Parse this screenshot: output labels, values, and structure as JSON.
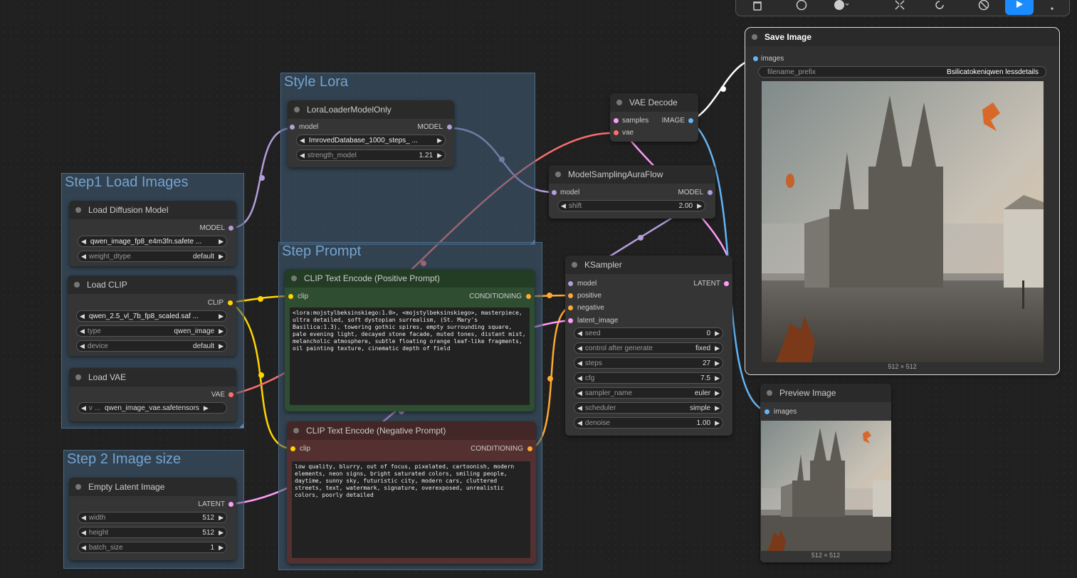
{
  "groups": {
    "style_lora": "Style Lora",
    "load_images": "Step1 Load Images",
    "prompt": "Step Prompt",
    "image_size": "Step 2 Image size"
  },
  "nodes": {
    "lora": {
      "title": "LoraLoaderModelOnly",
      "in_model": "model",
      "out_model": "MODEL",
      "lora_name": "ImrovedDatabase_1000_steps_ ...",
      "strength_label": "strength_model",
      "strength_value": "1.21"
    },
    "load_diffusion": {
      "title": "Load Diffusion Model",
      "out_model": "MODEL",
      "unet_name": "qwen_image_fp8_e4m3fn.safete ...",
      "weight_label": "weight_dtype",
      "weight_value": "default"
    },
    "load_clip": {
      "title": "Load CLIP",
      "out_clip": "CLIP",
      "clip_name": "qwen_2.5_vl_7b_fp8_scaled.saf ...",
      "type_label": "type",
      "type_value": "qwen_image",
      "device_label": "device",
      "device_value": "default"
    },
    "load_vae": {
      "title": "Load VAE",
      "out_vae": "VAE",
      "vae_label": "v ...",
      "vae_value": "qwen_image_vae.safetensors"
    },
    "empty_latent": {
      "title": "Empty Latent Image",
      "out_latent": "LATENT",
      "width_label": "width",
      "width_value": "512",
      "height_label": "height",
      "height_value": "512",
      "batch_label": "batch_size",
      "batch_value": "1"
    },
    "clip_positive": {
      "title": "CLIP Text Encode (Positive Prompt)",
      "in_clip": "clip",
      "out_cond": "CONDITIONING",
      "text": "<lora:mojstylbeksinskiego:1.0>, <mojstylbeksinskiego>, masterpiece, ultra detailed, soft dystopian surrealism, (St. Mary's Basilica:1.3), towering gothic spires, empty surrounding square, pale evening light, decayed stone facade, muted tones, distant mist, melancholic atmosphere, subtle floating orange leaf-like fragments, oil painting texture, cinematic depth of field"
    },
    "clip_negative": {
      "title": "CLIP Text Encode (Negative Prompt)",
      "in_clip": "clip",
      "out_cond": "CONDITIONING",
      "text": "low quality, blurry, out of focus, pixelated, cartoonish, modern elements, neon signs, bright saturated colors, smiling people, daytime, sunny sky, futuristic city, modern cars, cluttered streets, text, watermark, signature, overexposed, unrealistic colors, poorly detailed"
    },
    "vae_decode": {
      "title": "VAE Decode",
      "in_samples": "samples",
      "in_vae": "vae",
      "out_image": "IMAGE"
    },
    "model_sampling": {
      "title": "ModelSamplingAuraFlow",
      "in_model": "model",
      "out_model": "MODEL",
      "shift_label": "shift",
      "shift_value": "2.00"
    },
    "ksampler": {
      "title": "KSampler",
      "in_model": "model",
      "in_positive": "positive",
      "in_negative": "negative",
      "in_latent": "latent_image",
      "out_latent": "LATENT",
      "widgets": [
        {
          "label": "seed",
          "value": "0"
        },
        {
          "label": "control after generate",
          "value": "fixed"
        },
        {
          "label": "steps",
          "value": "27"
        },
        {
          "label": "cfg",
          "value": "7.5"
        },
        {
          "label": "sampler_name",
          "value": "euler"
        },
        {
          "label": "scheduler",
          "value": "simple"
        },
        {
          "label": "denoise",
          "value": "1.00"
        }
      ]
    },
    "save_image": {
      "title": "Save Image",
      "in_images": "images",
      "prefix_label": "filename_prefix",
      "prefix_value": "Bsilicatokeniqwen lessdetails",
      "dimensions": "512 × 512"
    },
    "preview_image": {
      "title": "Preview Image",
      "in_images": "images",
      "dimensions": "512 × 512"
    }
  },
  "toolbar": {
    "icons": [
      "trash-icon",
      "info-icon",
      "color-icon",
      "collapse-icon",
      "refresh-icon",
      "bypass-icon",
      "run-icon",
      "more-icon"
    ]
  },
  "colors": {
    "model": "#b39ddb",
    "clip": "#ffd500",
    "vae": "#ff6e6e",
    "conditioning": "#ffa931",
    "latent": "#ff9cf9",
    "image": "#64b5f6",
    "positive_bg": "#2f4d30",
    "negative_bg": "#553030"
  }
}
